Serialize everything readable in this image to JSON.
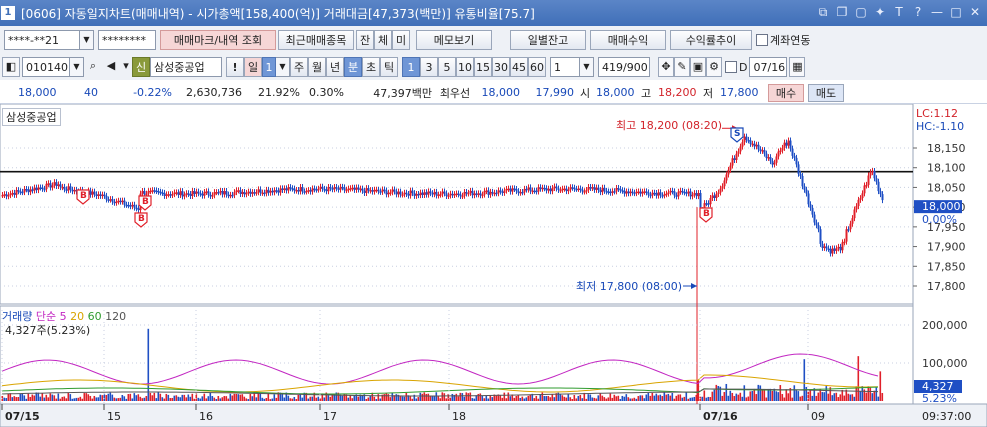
{
  "title": {
    "num": "1",
    "text": "[0606] 자동일지차트(매매내역) - 시가총액[158,400(억)] 거래대금[47,373(백만)] 유통비율[75.7]"
  },
  "toolbar1": {
    "account": "****-**21",
    "password": "********",
    "btn_trade_mark": "매매마크/내역 조회",
    "btn_recent": "최근매매종목",
    "btn_jan": "잔",
    "btn_che": "체",
    "btn_mi": "미",
    "btn_memo": "메모보기",
    "btn_daily": "일별잔고",
    "btn_trade_profit": "매매수익",
    "btn_return_trend": "수익률추이",
    "account_link_label": "계좌연동"
  },
  "toolbar2": {
    "code": "010140",
    "credit_badge": "신",
    "stock_name": "삼성중공업",
    "period_day": "일",
    "period_count": "1",
    "btn_week": "주",
    "btn_month": "월",
    "btn_year": "년",
    "btn_minute": "분",
    "btn_sec": "초",
    "btn_tick": "틱",
    "intervals": [
      "1",
      "3",
      "5",
      "10",
      "15",
      "30",
      "45",
      "60"
    ],
    "interval_input": "1",
    "count": "419/900",
    "date_label": "D",
    "date_value": "07/16"
  },
  "quote": {
    "price": "18,000",
    "change": "40",
    "change_rate": "-0.22%",
    "volume": "2,630,736",
    "vol_ratio": "21.92%",
    "turnover": "0.30%",
    "amount": "47,397백만",
    "best_label": "최우선",
    "best_ask": "18,000",
    "best_bid": "17,990",
    "open_label": "시",
    "open": "18,000",
    "high_label": "고",
    "high": "18,200",
    "low_label": "저",
    "low": "17,800",
    "buy_label": "매수",
    "sell_label": "매도"
  },
  "chart_data": {
    "type": "candlestick",
    "stock_tag": "삼성중공업",
    "lc": "LC:1.12",
    "hc": "HC:-1.10",
    "price_ticks": [
      "18,150",
      "18,100",
      "18,050",
      "18,000",
      "17,950",
      "17,900",
      "17,850",
      "17,800"
    ],
    "current_price": "18,000",
    "current_rate": "0.00%",
    "ref_line": 18090,
    "high_annotation": "최고 18,200 (08:20)",
    "low_annotation": "최저 17,800 (08:00)",
    "trade_marks": [
      "B",
      "B",
      "B",
      "B",
      "S"
    ],
    "volume_label": "거래량",
    "ma_label": "단순",
    "ma_periods": [
      "5",
      "20",
      "60",
      "120"
    ],
    "ma_colors": [
      "#c227c2",
      "#d9a400",
      "#2f9b2f",
      "#555555"
    ],
    "volume_sub": "4,327주(5.23%)",
    "volume_ticks": [
      "200,000",
      "100,000"
    ],
    "current_volume": "4,327",
    "volume_rate": "5.23%",
    "x_ticks": [
      "07/15",
      "15",
      "16",
      "17",
      "18",
      "07/16",
      "09"
    ],
    "current_time": "09:37:00",
    "colors": {
      "up": "#e0202a",
      "down": "#1f4fc4",
      "grid": "#c8cfe0",
      "accent": "#1849b8"
    }
  }
}
